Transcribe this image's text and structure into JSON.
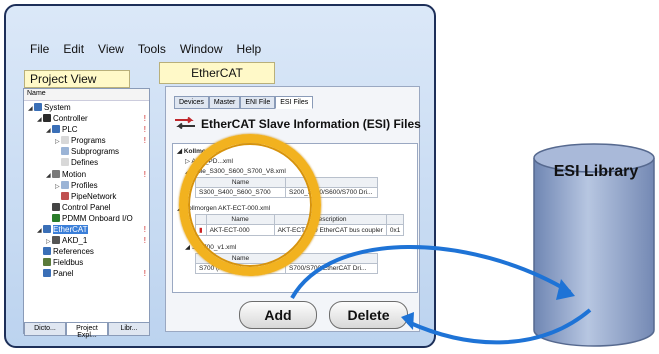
{
  "menu": [
    "File",
    "Edit",
    "View",
    "Tools",
    "Window",
    "Help"
  ],
  "project_view": {
    "title": "Project View",
    "column_header": "Name",
    "tree": [
      {
        "label": "System",
        "level": 0,
        "expand": "◢",
        "icon": "#3a6fb7"
      },
      {
        "label": "Controller",
        "level": 1,
        "expand": "◢",
        "icon": "#2b2b2b",
        "mark": "!"
      },
      {
        "label": "PLC",
        "level": 2,
        "expand": "◢",
        "icon": "#3a6fb7",
        "mark": "!"
      },
      {
        "label": "Programs",
        "level": 3,
        "expand": "▷",
        "icon": "#d8d8d8",
        "mark": "!"
      },
      {
        "label": "Subprograms",
        "level": 3,
        "expand": "",
        "icon": "#9bb4d6"
      },
      {
        "label": "Defines",
        "level": 3,
        "expand": "",
        "icon": "#d8d8d8"
      },
      {
        "label": "Motion",
        "level": 2,
        "expand": "◢",
        "icon": "#7a7a7a",
        "mark": "!"
      },
      {
        "label": "Profiles",
        "level": 3,
        "expand": "▷",
        "icon": "#9bb4d6"
      },
      {
        "label": "PipeNetwork",
        "level": 3,
        "expand": "",
        "icon": "#c05050"
      },
      {
        "label": "Control Panel",
        "level": 2,
        "expand": "",
        "icon": "#444"
      },
      {
        "label": "PDMM Onboard I/O",
        "level": 2,
        "expand": "",
        "icon": "#2a7d2a"
      },
      {
        "label": "EtherCAT",
        "level": 1,
        "expand": "◢",
        "icon": "#3a6fb7",
        "selected": true,
        "mark": "!"
      },
      {
        "label": "AKD_1",
        "level": 2,
        "expand": "▷",
        "icon": "#555",
        "mark": "!"
      },
      {
        "label": "References",
        "level": 1,
        "expand": "",
        "icon": "#3a6fb7"
      },
      {
        "label": "Fieldbus",
        "level": 1,
        "expand": "",
        "icon": "#5a7a3a"
      },
      {
        "label": "Panel",
        "level": 1,
        "expand": "",
        "icon": "#3a6fb7",
        "mark": "!"
      }
    ],
    "tabs": [
      "Dicto...",
      "Project Expl...",
      "Libr..."
    ]
  },
  "ethercat": {
    "title": "EtherCAT",
    "tabs": [
      "Devices",
      "Master",
      "ENI File",
      "ESI Files"
    ],
    "heading": "EtherCAT Slave Information (ESI) Files",
    "lines": {
      "root": "Kollmorgen",
      "f1": "AKD_PD...xml",
      "f2": "...ble_S300_S600_S700_V8.xml",
      "f3": "Kollmorgen AKT-ECT-000.xml",
      "f4": "S0x700_v1.xml"
    },
    "t1": {
      "header": "Name",
      "name": "S300_S400_S600_S700",
      "desc": "S200_S400/S600/S700 Dri..."
    },
    "t2": {
      "h1": "Name",
      "h2": "Description",
      "name": "AKT-ECT-000",
      "desc": "AKT-ECT-000 EtherCAT bus coupler",
      "extra": "0x1"
    },
    "t3": {
      "header": "Name",
      "name": "S700 (rev-coe)",
      "desc": "S700/S700 EtherCAT Dri..."
    },
    "add_label": "Add",
    "delete_label": "Delete"
  },
  "library": {
    "label": "ESI Library"
  },
  "colors": {
    "window_border": "#1d2f59",
    "highlight_ring": "#f2b21f",
    "arrow": "#1e73d6",
    "cylinder": "#8ea3c9"
  }
}
